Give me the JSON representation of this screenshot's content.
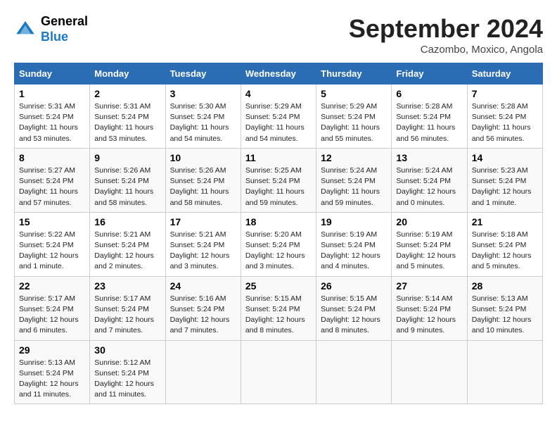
{
  "header": {
    "logo_line1": "General",
    "logo_line2": "Blue",
    "month": "September 2024",
    "location": "Cazombo, Moxico, Angola"
  },
  "columns": [
    "Sunday",
    "Monday",
    "Tuesday",
    "Wednesday",
    "Thursday",
    "Friday",
    "Saturday"
  ],
  "weeks": [
    [
      {
        "day": "1",
        "info": "Sunrise: 5:31 AM\nSunset: 5:24 PM\nDaylight: 11 hours\nand 53 minutes."
      },
      {
        "day": "2",
        "info": "Sunrise: 5:31 AM\nSunset: 5:24 PM\nDaylight: 11 hours\nand 53 minutes."
      },
      {
        "day": "3",
        "info": "Sunrise: 5:30 AM\nSunset: 5:24 PM\nDaylight: 11 hours\nand 54 minutes."
      },
      {
        "day": "4",
        "info": "Sunrise: 5:29 AM\nSunset: 5:24 PM\nDaylight: 11 hours\nand 54 minutes."
      },
      {
        "day": "5",
        "info": "Sunrise: 5:29 AM\nSunset: 5:24 PM\nDaylight: 11 hours\nand 55 minutes."
      },
      {
        "day": "6",
        "info": "Sunrise: 5:28 AM\nSunset: 5:24 PM\nDaylight: 11 hours\nand 56 minutes."
      },
      {
        "day": "7",
        "info": "Sunrise: 5:28 AM\nSunset: 5:24 PM\nDaylight: 11 hours\nand 56 minutes."
      }
    ],
    [
      {
        "day": "8",
        "info": "Sunrise: 5:27 AM\nSunset: 5:24 PM\nDaylight: 11 hours\nand 57 minutes."
      },
      {
        "day": "9",
        "info": "Sunrise: 5:26 AM\nSunset: 5:24 PM\nDaylight: 11 hours\nand 58 minutes."
      },
      {
        "day": "10",
        "info": "Sunrise: 5:26 AM\nSunset: 5:24 PM\nDaylight: 11 hours\nand 58 minutes."
      },
      {
        "day": "11",
        "info": "Sunrise: 5:25 AM\nSunset: 5:24 PM\nDaylight: 11 hours\nand 59 minutes."
      },
      {
        "day": "12",
        "info": "Sunrise: 5:24 AM\nSunset: 5:24 PM\nDaylight: 11 hours\nand 59 minutes."
      },
      {
        "day": "13",
        "info": "Sunrise: 5:24 AM\nSunset: 5:24 PM\nDaylight: 12 hours\nand 0 minutes."
      },
      {
        "day": "14",
        "info": "Sunrise: 5:23 AM\nSunset: 5:24 PM\nDaylight: 12 hours\nand 1 minute."
      }
    ],
    [
      {
        "day": "15",
        "info": "Sunrise: 5:22 AM\nSunset: 5:24 PM\nDaylight: 12 hours\nand 1 minute."
      },
      {
        "day": "16",
        "info": "Sunrise: 5:21 AM\nSunset: 5:24 PM\nDaylight: 12 hours\nand 2 minutes."
      },
      {
        "day": "17",
        "info": "Sunrise: 5:21 AM\nSunset: 5:24 PM\nDaylight: 12 hours\nand 3 minutes."
      },
      {
        "day": "18",
        "info": "Sunrise: 5:20 AM\nSunset: 5:24 PM\nDaylight: 12 hours\nand 3 minutes."
      },
      {
        "day": "19",
        "info": "Sunrise: 5:19 AM\nSunset: 5:24 PM\nDaylight: 12 hours\nand 4 minutes."
      },
      {
        "day": "20",
        "info": "Sunrise: 5:19 AM\nSunset: 5:24 PM\nDaylight: 12 hours\nand 5 minutes."
      },
      {
        "day": "21",
        "info": "Sunrise: 5:18 AM\nSunset: 5:24 PM\nDaylight: 12 hours\nand 5 minutes."
      }
    ],
    [
      {
        "day": "22",
        "info": "Sunrise: 5:17 AM\nSunset: 5:24 PM\nDaylight: 12 hours\nand 6 minutes."
      },
      {
        "day": "23",
        "info": "Sunrise: 5:17 AM\nSunset: 5:24 PM\nDaylight: 12 hours\nand 7 minutes."
      },
      {
        "day": "24",
        "info": "Sunrise: 5:16 AM\nSunset: 5:24 PM\nDaylight: 12 hours\nand 7 minutes."
      },
      {
        "day": "25",
        "info": "Sunrise: 5:15 AM\nSunset: 5:24 PM\nDaylight: 12 hours\nand 8 minutes."
      },
      {
        "day": "26",
        "info": "Sunrise: 5:15 AM\nSunset: 5:24 PM\nDaylight: 12 hours\nand 8 minutes."
      },
      {
        "day": "27",
        "info": "Sunrise: 5:14 AM\nSunset: 5:24 PM\nDaylight: 12 hours\nand 9 minutes."
      },
      {
        "day": "28",
        "info": "Sunrise: 5:13 AM\nSunset: 5:24 PM\nDaylight: 12 hours\nand 10 minutes."
      }
    ],
    [
      {
        "day": "29",
        "info": "Sunrise: 5:13 AM\nSunset: 5:24 PM\nDaylight: 12 hours\nand 11 minutes."
      },
      {
        "day": "30",
        "info": "Sunrise: 5:12 AM\nSunset: 5:24 PM\nDaylight: 12 hours\nand 11 minutes."
      },
      {
        "day": "",
        "info": ""
      },
      {
        "day": "",
        "info": ""
      },
      {
        "day": "",
        "info": ""
      },
      {
        "day": "",
        "info": ""
      },
      {
        "day": "",
        "info": ""
      }
    ]
  ]
}
